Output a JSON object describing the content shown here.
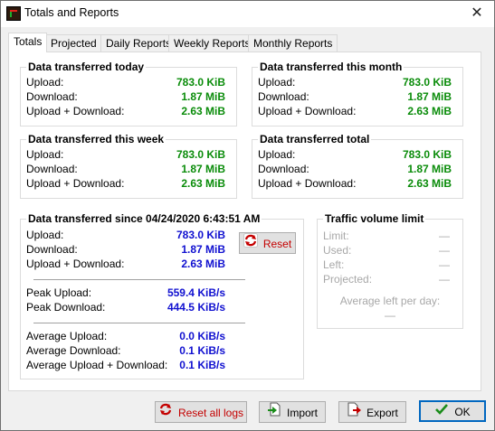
{
  "window": {
    "title": "Totals and Reports",
    "close": "✕"
  },
  "tabs": [
    "Totals",
    "Projected",
    "Daily Reports",
    "Weekly Reports",
    "Monthly Reports"
  ],
  "labels": {
    "upload": "Upload:",
    "download": "Download:",
    "both": "Upload + Download:"
  },
  "today": {
    "title": "Data transferred today",
    "upload": "783.0 KiB",
    "download": "1.87 MiB",
    "both": "2.63 MiB"
  },
  "month": {
    "title": "Data transferred this month",
    "upload": "783.0 KiB",
    "download": "1.87 MiB",
    "both": "2.63 MiB"
  },
  "week": {
    "title": "Data transferred this week",
    "upload": "783.0 KiB",
    "download": "1.87 MiB",
    "both": "2.63 MiB"
  },
  "total": {
    "title": "Data transferred total",
    "upload": "783.0 KiB",
    "download": "1.87 MiB",
    "both": "2.63 MiB"
  },
  "since": {
    "title": "Data transferred since 04/24/2020 6:43:51 AM",
    "upload": "783.0 KiB",
    "download": "1.87 MiB",
    "both": "2.63 MiB",
    "reset_label": "Reset",
    "peak_upload_label": "Peak Upload:",
    "peak_upload": "559.4 KiB/s",
    "peak_download_label": "Peak Download:",
    "peak_download": "444.5 KiB/s",
    "avg_upload_label": "Average Upload:",
    "avg_upload": "0.0 KiB/s",
    "avg_download_label": "Average Download:",
    "avg_download": "0.1 KiB/s",
    "avg_both_label": "Average Upload + Download:",
    "avg_both": "0.1 KiB/s"
  },
  "limit": {
    "title": "Traffic volume limit",
    "limit_label": "Limit:",
    "limit": "—",
    "used_label": "Used:",
    "used": "—",
    "left_label": "Left:",
    "left": "—",
    "projected_label": "Projected:",
    "projected": "—",
    "avg_left_label": "Average left per day:",
    "avg_left": "—"
  },
  "buttons": {
    "reset_all": "Reset all logs",
    "import": "Import",
    "export": "Export",
    "ok": "OK"
  },
  "colors": {
    "value_green": "#0a8c0a",
    "value_blue": "#1010d0",
    "reset_red": "#c40000"
  }
}
